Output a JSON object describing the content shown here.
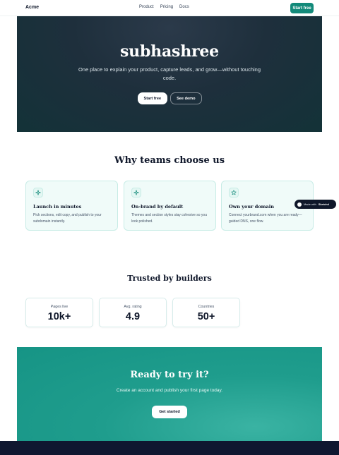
{
  "nav": {
    "brand": "Acme",
    "links": [
      "Product",
      "Pricing",
      "Docs"
    ],
    "cta": "Start free"
  },
  "hero": {
    "title": "subhashree",
    "subtitle": "One place to explain your product, capture leads, and grow—without touching code.",
    "primary_button": "Start free",
    "secondary_button": "See demo"
  },
  "why": {
    "title": "Why teams choose us",
    "cards": [
      {
        "icon": "sparkle-icon",
        "title": "Launch in minutes",
        "body": "Pick sections, edit copy, and publish to your subdomain instantly."
      },
      {
        "icon": "sparkle-icon",
        "title": "On-brand by default",
        "body": "Themes and section styles stay cohesive so you look polished."
      },
      {
        "icon": "star-icon",
        "title": "Own your domain",
        "body": "Connect yourbrand.com when you are ready—guided DNS, one flow."
      }
    ]
  },
  "badge": {
    "prefix": "Made with",
    "name": "Sketchd"
  },
  "trust": {
    "title": "Trusted by builders",
    "stats": [
      {
        "label": "Pages live",
        "value": "10k+"
      },
      {
        "label": "Avg. rating",
        "value": "4.9"
      },
      {
        "label": "Countries",
        "value": "50+"
      }
    ]
  },
  "cta": {
    "title": "Ready to try it?",
    "subtitle": "Create an account and publish your first page today.",
    "button": "Get started"
  },
  "colors": {
    "accent": "#138a7a",
    "hero_bg": "#1e2f3c",
    "cta_bg": "#1f9d8d",
    "footer_bg": "#0f1730"
  }
}
